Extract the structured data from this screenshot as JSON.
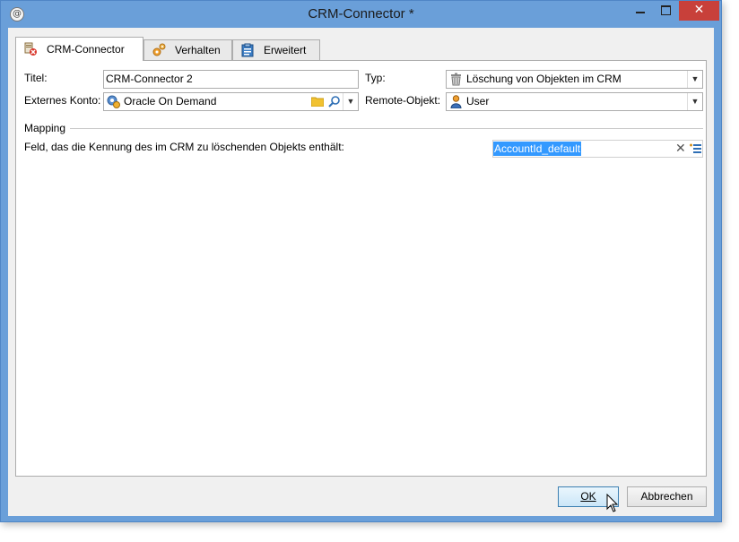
{
  "window": {
    "title": "CRM-Connector *",
    "app_icon_glyph": "@",
    "close_glyph": "✕"
  },
  "tabs": [
    {
      "label": "CRM-Connector",
      "icon": "crm-connector-icon",
      "active": true
    },
    {
      "label": "Verhalten",
      "icon": "gears-icon",
      "active": false
    },
    {
      "label": "Erweitert",
      "icon": "clipboard-icon",
      "active": false
    }
  ],
  "form": {
    "title_label": "Titel:",
    "title_value": "CRM-Connector 2",
    "type_label": "Typ:",
    "type_value": "Löschung von Objekten im CRM",
    "type_icon": "trash-icon",
    "account_label": "Externes Konto:",
    "account_value": "Oracle On Demand",
    "account_icon": "external-account-icon",
    "remote_label": "Remote-Objekt:",
    "remote_value": "User",
    "remote_icon": "user-icon"
  },
  "mapping": {
    "section_label": "Mapping",
    "field_label": "Feld, das die Kennung des im CRM zu löschenden Objekts enthält:",
    "field_value": "AccountId_default"
  },
  "buttons": {
    "ok": "OK",
    "cancel": "Abbrechen"
  },
  "colors": {
    "titlebar": "#6a9fd9",
    "close": "#c8403a",
    "selection": "#3399ff"
  }
}
